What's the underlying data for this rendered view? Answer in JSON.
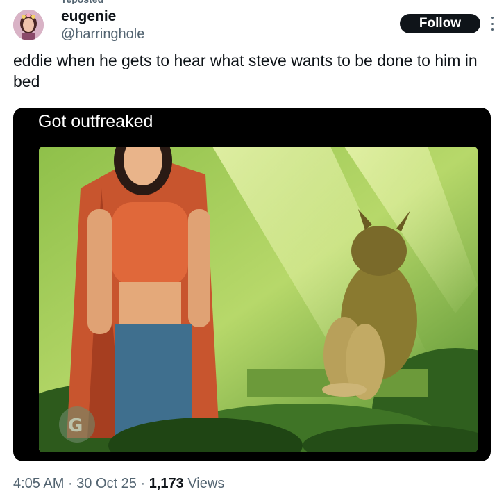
{
  "tweet": {
    "repost_label": "reposted",
    "author": {
      "display_name": "eugenie",
      "handle": "@harringhole"
    },
    "follow_label": "Follow",
    "text": "eddie when he gets to hear what steve wants to be done to him in bed",
    "media": {
      "caption": "Got outfreaked"
    },
    "meta": {
      "time": "4:05 AM",
      "separator": "·",
      "date": "30 Oct 25",
      "views_count": "1,173",
      "views_label": "Views"
    }
  },
  "colors": {
    "text_primary": "#0f1419",
    "text_secondary": "#536471",
    "button_bg": "#0f1419",
    "media_bg": "#000000"
  },
  "icons": [
    "more-options-icon",
    "avatar-image"
  ]
}
